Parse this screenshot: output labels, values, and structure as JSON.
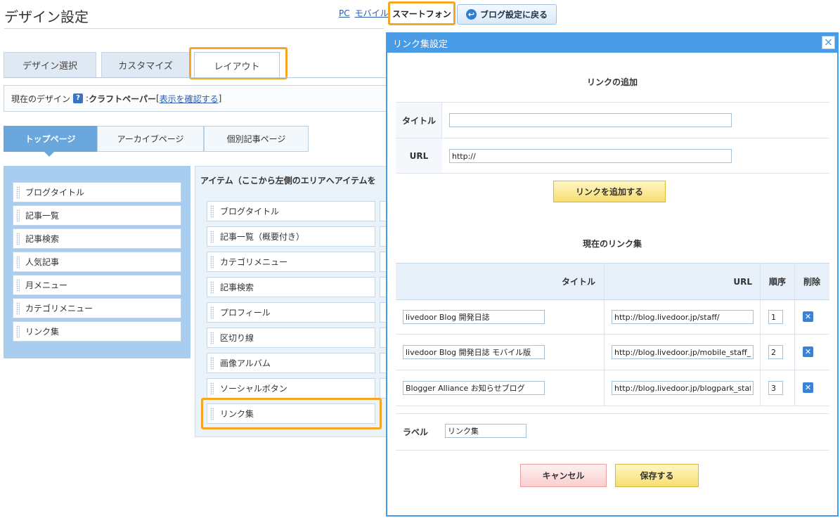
{
  "header": {
    "title": "デザイン設定",
    "device_links": [
      "PC",
      "モバイル"
    ],
    "smartphone_label": "スマートフォン",
    "back_label": "ブログ設定に戻る"
  },
  "main_tabs": [
    "デザイン選択",
    "カスタマイズ",
    "レイアウト"
  ],
  "design_bar": {
    "prefix": "現在のデザイン",
    "help": "?",
    "sep": ":",
    "name": "クラフトペーパー",
    "bracket_open": "[",
    "confirm_link": "表示を確認する",
    "bracket_close": "]"
  },
  "sub_tabs": [
    "トップページ",
    "アーカイブページ",
    "個別記事ページ"
  ],
  "left_items": [
    "ブログタイトル",
    "記事一覧",
    "記事検索",
    "人気記事",
    "月メニュー",
    "カテゴリメニュー",
    "リンク集"
  ],
  "palette": {
    "heading": "アイテム（ここから左側のエリアへアイテムを",
    "items": [
      "ブログタイトル",
      "記事一覧（概要付き）",
      "カテゴリメニュー",
      "記事検索",
      "プロフィール",
      "区切り線",
      "画像アルバム",
      "ソーシャルボタン",
      "リンク集"
    ]
  },
  "dialog": {
    "title": "リンク集設定",
    "close": "×",
    "add_section_title": "リンクの追加",
    "title_label": "タイトル",
    "title_value": "",
    "url_label": "URL",
    "url_value": "http://",
    "add_button": "リンクを追加する",
    "current_section_title": "現在のリンク集",
    "table_headers": {
      "title": "タイトル",
      "url": "URL",
      "order": "順序",
      "delete": "削除"
    },
    "rows": [
      {
        "title": "livedoor Blog 開発日誌",
        "url": "http://blog.livedoor.jp/staff/",
        "order": "1"
      },
      {
        "title": "livedoor Blog 開発日誌 モバイル版",
        "url": "http://blog.livedoor.jp/mobile_staff_b",
        "order": "2"
      },
      {
        "title": "Blogger Alliance お知らせブログ",
        "url": "http://blog.livedoor.jp/blogpark_staf",
        "order": "3"
      }
    ],
    "delete_icon": "✕",
    "label_label": "ラベル",
    "label_value": "リンク集",
    "cancel_button": "キャンセル",
    "save_button": "保存する"
  },
  "colors": {
    "accent_highlight": "#f5a623",
    "dialog_blue": "#4a9be6",
    "left_area": "#a9cdee"
  }
}
